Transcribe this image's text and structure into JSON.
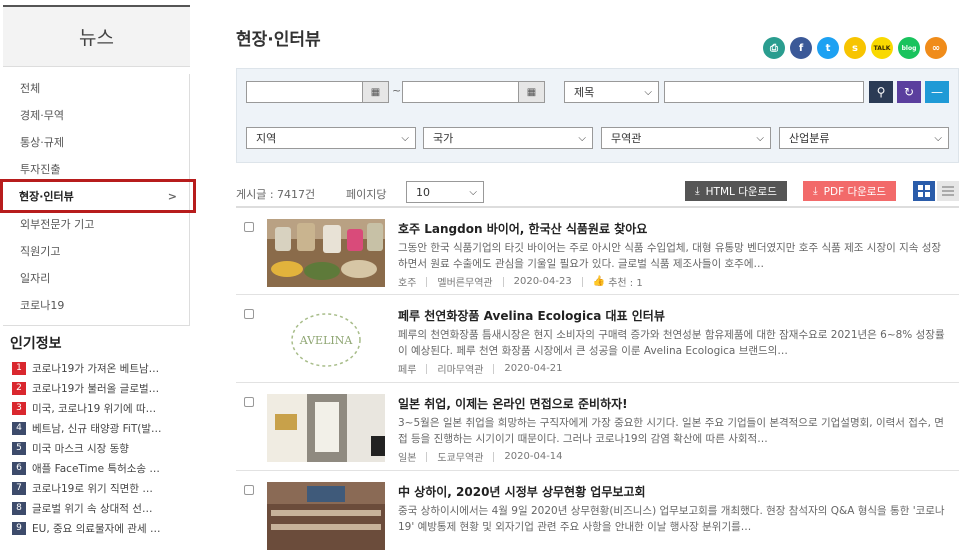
{
  "sidebar": {
    "title": "뉴스",
    "items": [
      {
        "label": "전체",
        "active": false
      },
      {
        "label": "경제·무역",
        "active": false
      },
      {
        "label": "통상·규제",
        "active": false
      },
      {
        "label": "투자진출",
        "active": false
      },
      {
        "label": "현장·인터뷰",
        "active": true
      },
      {
        "label": "외부전문가 기고",
        "active": false
      },
      {
        "label": "직원기고",
        "active": false
      },
      {
        "label": "일자리",
        "active": false
      },
      {
        "label": "코로나19",
        "active": false
      }
    ],
    "active_chevron": ">"
  },
  "popular": {
    "title": "인기정보",
    "items": [
      {
        "num": "1",
        "label": "코로나19가 가져온 베트남…"
      },
      {
        "num": "2",
        "label": "코로나19가 불러올 글로벌…"
      },
      {
        "num": "3",
        "label": "미국, 코로나19 위기에 따…"
      },
      {
        "num": "4",
        "label": "베트남, 신규 태양광 FiT(발…"
      },
      {
        "num": "5",
        "label": "미국 마스크 시장 동향"
      },
      {
        "num": "6",
        "label": "애플 FaceTime 특허소송 …"
      },
      {
        "num": "7",
        "label": "코로나19로 위기 직면한 …"
      },
      {
        "num": "8",
        "label": "글로벌 위기 속 상대적 선…"
      },
      {
        "num": "9",
        "label": "EU, 중요 의료물자에 관세 …"
      }
    ]
  },
  "page": {
    "title": "현장·인터뷰"
  },
  "share": [
    {
      "icon": "print-icon",
      "glyph": "⎙",
      "color": "#2a9d8f"
    },
    {
      "icon": "facebook-icon",
      "glyph": "f",
      "color": "#3b5998"
    },
    {
      "icon": "twitter-icon",
      "glyph": "t",
      "color": "#1da1f2"
    },
    {
      "icon": "kakaostory-icon",
      "glyph": "s",
      "color": "#f7c400"
    },
    {
      "icon": "kakaotalk-icon",
      "glyph": "TALK",
      "color": "#f9d900"
    },
    {
      "icon": "naver-blog-icon",
      "glyph": "blog",
      "color": "#19c35d"
    },
    {
      "icon": "link-icon",
      "glyph": "∞",
      "color": "#f08c1a"
    }
  ],
  "search": {
    "date_tilde": "~",
    "field_select": "제목",
    "filters": [
      "지역",
      "국가",
      "무역관",
      "산업분류"
    ]
  },
  "list": {
    "count_label": "게시글 : 7417건",
    "per_page_label": "페이지당",
    "per_page_value": "10",
    "html_download": "HTML 다운로드",
    "pdf_download": "PDF 다운로드"
  },
  "articles": [
    {
      "title": "호주 Langdon 바이어, 한국산 식품원료 찾아요",
      "summary": "그동안 한국 식품기업의 타깃 바이어는 주로 아시안 식품 수입업체, 대형 유통망 벤더였지만 호주 식품 제조 시장이 지속 성장하면서 원료 수출에도 관심을 기울일 필요가 있다. 글로벌 식품 제조사들이 호주에…",
      "country": "호주",
      "office": "멜버른무역관",
      "date": "2020-04-23",
      "recommend": "추천 : 1"
    },
    {
      "title": "페루 천연화장품 Avelina Ecologica 대표 인터뷰",
      "summary": "페루의 천연화장품 틈새시장은 현지 소비자의 구매력 증가와 천연성분 함유제품에 대한 잠재수요로 2021년은 6~8% 성장률이 예상된다. 페루 천연 화장품 시장에서 큰 성공을 이룬 Avelina Ecologica 브랜드의…",
      "country": "페루",
      "office": "리마무역관",
      "date": "2020-04-21",
      "thumb_text": "AVELINA"
    },
    {
      "title": "일본 취업, 이제는 온라인 면접으로 준비하자!",
      "summary": "3~5월은 일본 취업을 희망하는 구직자에게 가장 중요한 시기다. 일본 주요 기업들이 본격적으로 기업설명회, 이력서 접수, 면접 등을 진행하는 시기이기 때문이다. 그러나 코로나19의 감염 확산에 따른 사회적…",
      "country": "일본",
      "office": "도쿄무역관",
      "date": "2020-04-14"
    },
    {
      "title": "中 상하이, 2020년 시정부 상무현황 업무보고회",
      "summary": "중국 상하이시에서는 4월 9일 2020년 상무현황(비즈니스) 업무보고회를 개최했다. 현장 참석자의 Q&A 형식을 통한 '코로나19' 예방통제 현황 및 외자기업 관련 주요 사항을 안내한 이날 행사장 분위기를…",
      "country": "",
      "office": "",
      "date": ""
    }
  ]
}
